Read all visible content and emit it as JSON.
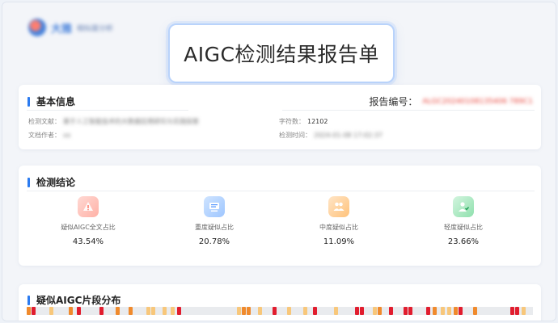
{
  "header": {
    "logo_text": "大雅",
    "logo_sub": "相似度分析",
    "title": "AIGC检测结果报告单"
  },
  "basic_info": {
    "section_title": "基本信息",
    "report_no_label": "报告编号：",
    "report_no_value": "ALGC20240108135406 789C1",
    "doc_label": "检测文献：",
    "doc_value": "基于人工智能技术的大数据应用研究与实践探索",
    "author_label": "文档作者：",
    "author_value": "xx",
    "chars_label": "字符数：",
    "chars_value": "12102",
    "time_label": "检测时间：",
    "time_value": "2024-01-08 17:02:37"
  },
  "conclusion": {
    "section_title": "检测结论",
    "stats": [
      {
        "label": "疑似AIGC全文占比",
        "value": "43.54%",
        "icon": "document-warning-icon",
        "color": "#ff8a7a"
      },
      {
        "label": "重度疑似占比",
        "value": "20.78%",
        "icon": "monitor-icon",
        "color": "#4f93ff"
      },
      {
        "label": "中度疑似占比",
        "value": "11.09%",
        "icon": "people-icon",
        "color": "#ff9f3d"
      },
      {
        "label": "轻度疑似占比",
        "value": "23.66%",
        "icon": "user-check-icon",
        "color": "#2dbd6b"
      }
    ]
  },
  "distribution": {
    "section_title": "疑似AIGC片段分布",
    "colors": {
      "severe": "#e11d2e",
      "moderate": "#f08a2c",
      "light": "#f8c77a"
    }
  }
}
